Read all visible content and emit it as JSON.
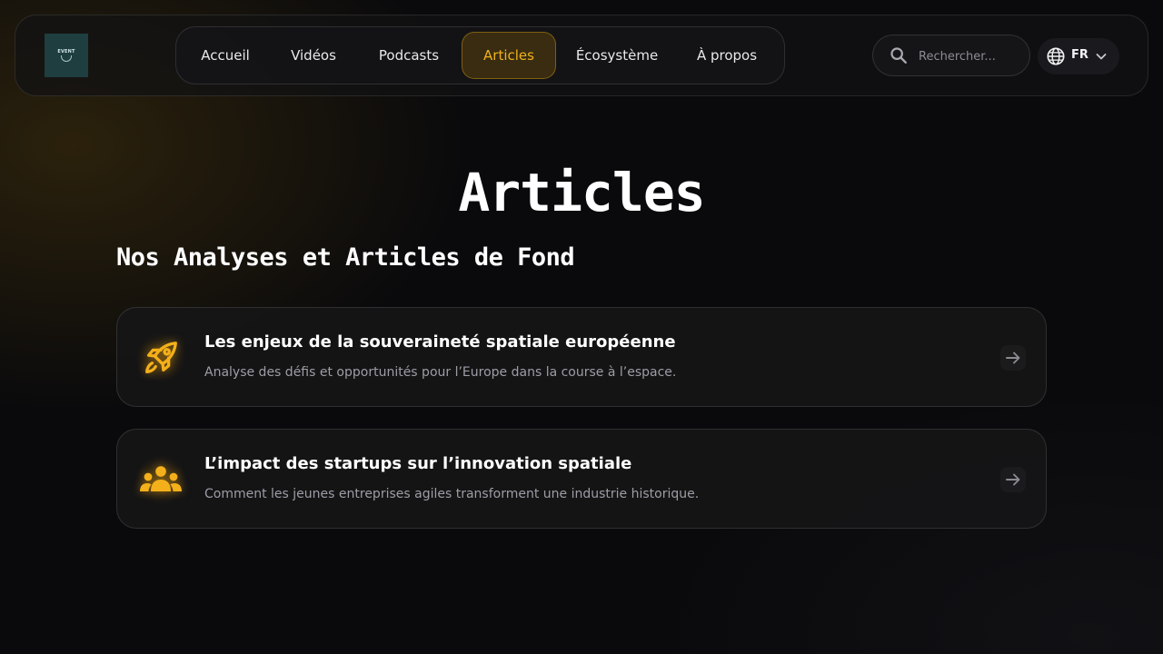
{
  "header": {
    "logo": {
      "text": "EVENT",
      "icon": "logo-icon"
    },
    "nav": [
      {
        "label": "Accueil",
        "active": false
      },
      {
        "label": "Vidéos",
        "active": false
      },
      {
        "label": "Podcasts",
        "active": false
      },
      {
        "label": "Articles",
        "active": true
      },
      {
        "label": "Écosystème",
        "active": false
      },
      {
        "label": "À propos",
        "active": false
      }
    ],
    "search": {
      "placeholder": "Rechercher...",
      "value": "",
      "icon": "search-icon"
    },
    "language": {
      "label": "FR",
      "icon": "globe-icon",
      "chevron": "chevron-down-icon"
    }
  },
  "main": {
    "title": "Articles",
    "section_title": "Nos Analyses et Articles de Fond",
    "articles": [
      {
        "title": "Les enjeux de la souveraineté spatiale européenne",
        "description": "Analyse des défis et opportunités pour l’Europe dans la course à l’espace.",
        "icon": "rocket-icon"
      },
      {
        "title": "L’impact des startups sur l’innovation spatiale",
        "description": "Comment les jeunes entreprises agiles transforment une industrie historique.",
        "icon": "group-icon"
      }
    ]
  },
  "colors": {
    "accent": "#f0b21c",
    "background": "#0a0a0c",
    "muted_text": "#9d9da6"
  }
}
